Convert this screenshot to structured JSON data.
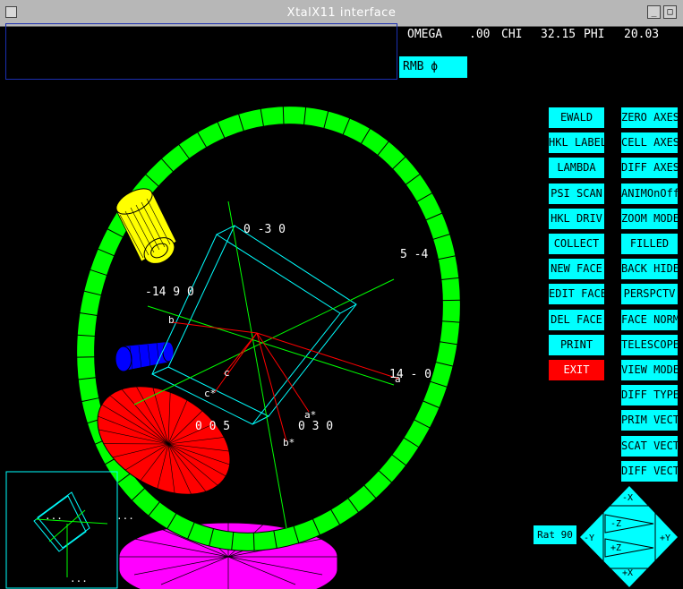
{
  "window": {
    "title": "XtalX11 interface",
    "btn_min": "_",
    "btn_max": "□"
  },
  "status": {
    "omega_label": "OMEGA",
    "omega_value": ".00",
    "chi_label": "CHI",
    "chi_value": "32.15",
    "phi_label": "PHI",
    "phi_value": "20.03"
  },
  "rmb_label": "RMB ϕ",
  "left_buttons": [
    "EWALD",
    "HKL LABEL",
    "LAMBDA",
    "PSI SCAN",
    "HKL DRIV",
    "COLLECT",
    "NEW FACE",
    "EDIT FACE",
    "DEL FACE",
    "PRINT",
    "EXIT"
  ],
  "right_buttons": [
    "ZERO AXES",
    "CELL AXES",
    "DIFF AXES",
    "ANIMOnOff",
    "ZOOM MODE",
    "FILLED",
    "BACK HIDE",
    "PERSPCTV",
    "FACE NORM",
    "TELESCOPE",
    "VIEW MODE",
    "DIFF TYPE",
    "PRIM VECT",
    "SCAT VECT",
    "DIFF VECT"
  ],
  "rotation": {
    "rot_label": "Rat 90",
    "neg_x": "-X",
    "pos_x": "+X",
    "neg_y": "-Y",
    "pos_y": "+Y",
    "neg_z": "-Z",
    "pos_z": "+Z"
  },
  "scene_labels": {
    "hkl_top": "0  -3   0",
    "hkl_right_top": "5  -4",
    "hkl_left": "-14   9   0",
    "hkl_right": "14  -   0",
    "hkl_bottom": "0   0   5",
    "hkl_bottom_right": "0   3   0",
    "axis_b": "b",
    "axis_c": "c",
    "axis_cstar": "c*",
    "axis_astar": "a*",
    "axis_bstar": "b*",
    "axis_a": "a",
    "mini_dots_1": "...",
    "mini_dots_2": "...",
    "mini_dots_3": "..."
  },
  "colors": {
    "background": "#000000",
    "ring": "#00ff00",
    "button": "#00ffff",
    "exit_button": "#ff0000",
    "telescope": "#ffff00",
    "collimator": "#0000ff",
    "detector": "#ff0000",
    "base": "#ff00ff",
    "crystal": "#00ffff"
  }
}
